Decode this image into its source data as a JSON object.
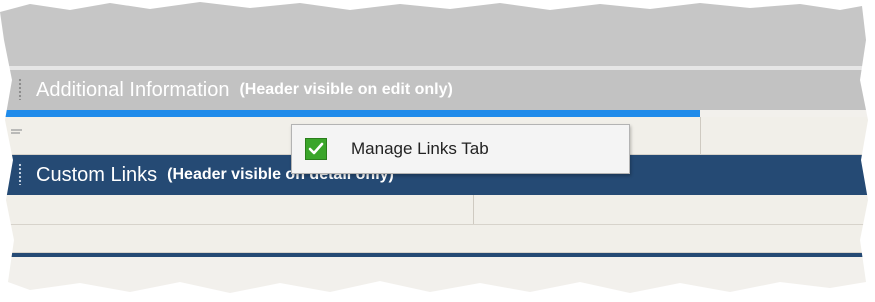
{
  "sections": {
    "additional": {
      "title": "Additional Information",
      "note": "(Header visible on edit only)"
    },
    "custom": {
      "title": "Custom Links",
      "note": "(Header visible on detail only)"
    }
  },
  "popup": {
    "label": "Manage Links Tab",
    "icon": "checkbox-checked-icon"
  },
  "colors": {
    "section_header_gray": "#c2c2c2",
    "section_header_navy": "#254a74",
    "drop_indicator": "#1f8bea",
    "check_green": "#3aa52a"
  }
}
